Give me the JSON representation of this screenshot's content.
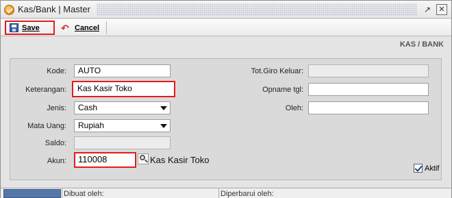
{
  "window": {
    "title": "Kas/Bank | Master",
    "restore_glyph": "↗",
    "close_glyph": "✕"
  },
  "toolbar": {
    "save_label": "Save",
    "cancel_label": "Cancel"
  },
  "section_title": "KAS / BANK",
  "form": {
    "kode": {
      "label": "Kode:",
      "value": "AUTO"
    },
    "keterangan": {
      "label": "Keterangan:",
      "value": "Kas Kasir Toko"
    },
    "jenis": {
      "label": "Jenis:",
      "value": "Cash"
    },
    "mata_uang": {
      "label": "Mata Uang:",
      "value": "Rupiah"
    },
    "saldo": {
      "label": "Saldo:",
      "value": ""
    },
    "akun": {
      "label": "Akun:",
      "value": "110008",
      "name": "Kas Kasir Toko"
    },
    "tot_giro_keluar": {
      "label": "Tot.Giro Keluar:",
      "value": ""
    },
    "opname_tgl": {
      "label": "Opname tgl:",
      "value": ""
    },
    "oleh": {
      "label": "Oleh:",
      "value": ""
    },
    "aktif": {
      "label": "Aktif",
      "checked": true
    }
  },
  "statusbar": {
    "dibuat_oleh": "Dibuat oleh:",
    "diperbarui_oleh": "Diperbarui oleh:"
  },
  "icons": [
    "app-icon",
    "restore-icon",
    "close-icon",
    "save-icon",
    "cancel-undo-icon",
    "dropdown-arrow-icon",
    "lookup-search-icon",
    "checkbox-check-icon"
  ],
  "colors": {
    "highlight": "#e21b1b",
    "status_blue": "#5676a8"
  }
}
